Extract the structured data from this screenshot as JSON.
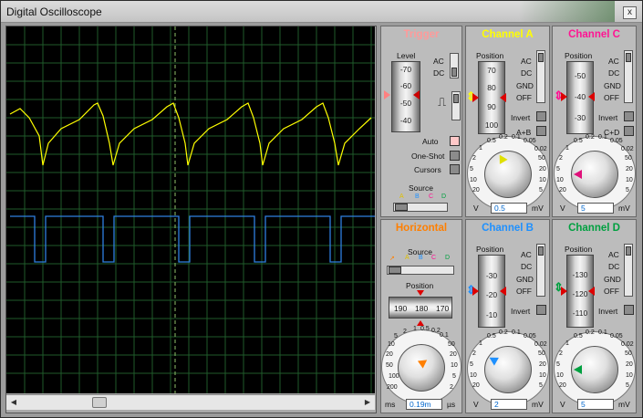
{
  "window": {
    "title": "Digital Oscilloscope",
    "close_label": "x"
  },
  "trigger": {
    "title": "Trigger",
    "level_label": "Level",
    "level_ticks": [
      "-70",
      "-60",
      "-50",
      "-40"
    ],
    "ac": "AC",
    "dc": "DC",
    "auto": "Auto",
    "one_shot": "One-Shot",
    "cursors": "Cursors",
    "source": "Source",
    "sources": [
      "A",
      "B",
      "C",
      "D"
    ]
  },
  "channel_a": {
    "title": "Channel A",
    "position_label": "Position",
    "ticks": [
      "70",
      "80",
      "90",
      "100"
    ],
    "ac": "AC",
    "dc": "DC",
    "gnd": "GND",
    "off": "OFF",
    "invert": "Invert",
    "combine": "A+B",
    "dial": [
      "0.1",
      "0.2",
      "0.5",
      "1",
      "2",
      "5",
      "10",
      "20",
      "50",
      "20",
      "10",
      "5",
      "2",
      "1",
      "0.5",
      "0.2"
    ],
    "v": "V",
    "mv": "mV",
    "value": "0.5"
  },
  "channel_b": {
    "title": "Channel B",
    "position_label": "Position",
    "ticks": [
      "-30",
      "-20",
      "-10"
    ],
    "ac": "AC",
    "dc": "DC",
    "gnd": "GND",
    "off": "OFF",
    "invert": "Invert",
    "v": "V",
    "mv": "mV",
    "value": "2"
  },
  "channel_c": {
    "title": "Channel C",
    "position_label": "Position",
    "ticks": [
      "-50",
      "-40",
      "-30"
    ],
    "ac": "AC",
    "dc": "DC",
    "gnd": "GND",
    "off": "OFF",
    "invert": "Invert",
    "combine": "C+D",
    "v": "V",
    "mv": "mV",
    "value": "5"
  },
  "channel_d": {
    "title": "Channel D",
    "position_label": "Position",
    "ticks": [
      "-130",
      "-120",
      "-110"
    ],
    "ac": "AC",
    "dc": "DC",
    "gnd": "GND",
    "off": "OFF",
    "invert": "Invert",
    "v": "V",
    "mv": "mV",
    "value": "5"
  },
  "horizontal": {
    "title": "Horizontal",
    "source": "Source",
    "sources": [
      "A",
      "B",
      "C",
      "D"
    ],
    "position_label": "Position",
    "ticks": [
      "190",
      "180",
      "170"
    ],
    "ms": "ms",
    "us": "µs",
    "value": "0.19m",
    "dial": [
      "0.5",
      "1",
      "2",
      "5",
      "10",
      "20",
      "50",
      "100",
      "200",
      "0.1",
      "0.2",
      "0.5",
      "1",
      "2",
      "5",
      "10",
      "20",
      "50",
      "100",
      "200"
    ]
  },
  "colors": {
    "channel_a": "#ffff00",
    "channel_b": "#1e90ff",
    "channel_c": "#ff1493",
    "channel_d": "#00b050",
    "trigger": "#ff8080",
    "horizontal": "#ff7f00"
  }
}
